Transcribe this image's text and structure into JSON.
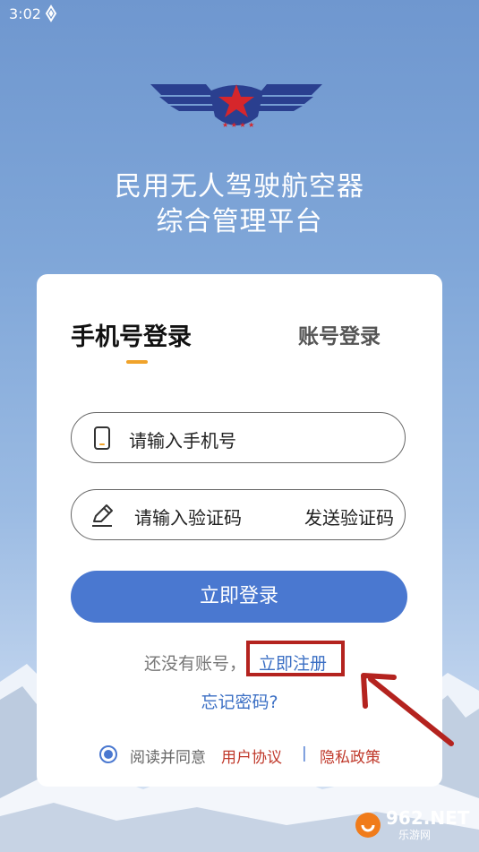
{
  "status_bar": {
    "time": "3:02"
  },
  "app": {
    "title_line1": "民用无人驾驶航空器",
    "title_line2": "综合管理平台"
  },
  "tabs": {
    "active": "手机号登录",
    "inactive": "账号登录"
  },
  "phone_field": {
    "placeholder": "请输入手机号",
    "icon": "phone-icon"
  },
  "code_field": {
    "placeholder": "请输入验证码",
    "icon": "pen-icon",
    "send_code_label": "发送验证码"
  },
  "login_button": {
    "label": "立即登录"
  },
  "register": {
    "prompt": "还没有账号，",
    "link": "立即注册"
  },
  "forgot_password": "忘记密码?",
  "agreement": {
    "checked": true,
    "prefix": "阅读并同意",
    "user_agreement": "用户协议",
    "separator": "|",
    "privacy_policy": "隐私政策"
  },
  "watermark": {
    "brand": "962.NET",
    "sub": "乐游网"
  },
  "colors": {
    "primary": "#4a78d0",
    "accent_underline": "#f0a32b",
    "link": "#3b6fc4",
    "policy": "#c0392b",
    "highlight_box": "#b4231f"
  }
}
